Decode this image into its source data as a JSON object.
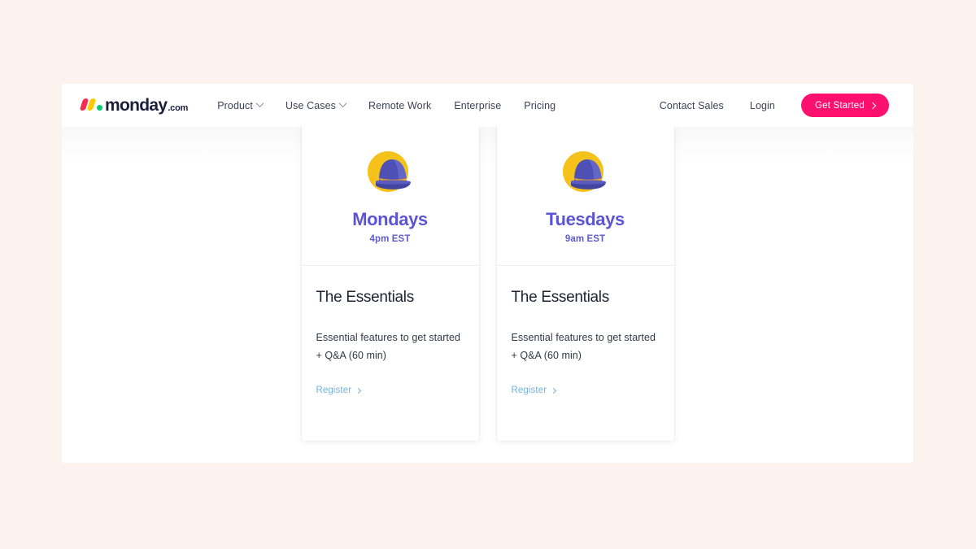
{
  "theme": {
    "outer_background": "#fdf3ee",
    "page_background": "#ffffff",
    "accent_pink": "#ff0f6e",
    "accent_purple": "#5b55d6",
    "link_blue": "#73b4e0",
    "hat_yellow": "#f4c21b",
    "hat_blue": "#4a4bb0"
  },
  "nav": {
    "logo": {
      "word": "monday",
      "tld": ".com",
      "mark_colors": [
        "#f62b54",
        "#ffcb00",
        "#00ca72"
      ]
    },
    "left_links": [
      {
        "label": "Product",
        "has_dropdown": true
      },
      {
        "label": "Use Cases",
        "has_dropdown": true
      },
      {
        "label": "Remote Work",
        "has_dropdown": false
      },
      {
        "label": "Enterprise",
        "has_dropdown": false
      },
      {
        "label": "Pricing",
        "has_dropdown": false
      }
    ],
    "right_links": [
      {
        "label": "Contact Sales"
      },
      {
        "label": "Login"
      }
    ],
    "cta": {
      "label": "Get Started",
      "icon": "chevron-right-icon"
    }
  },
  "cards": [
    {
      "icon": "hat-icon",
      "day": "Mondays",
      "time": "4pm EST",
      "title": "The Essentials",
      "description": "Essential features to get started + Q&A (60 min)",
      "link_label": "Register",
      "link_icon": "chevron-right-icon"
    },
    {
      "icon": "hat-icon",
      "day": "Tuesdays",
      "time": "9am EST",
      "title": "The Essentials",
      "description": "Essential features to get started + Q&A (60 min)",
      "link_label": "Register",
      "link_icon": "chevron-right-icon"
    }
  ]
}
